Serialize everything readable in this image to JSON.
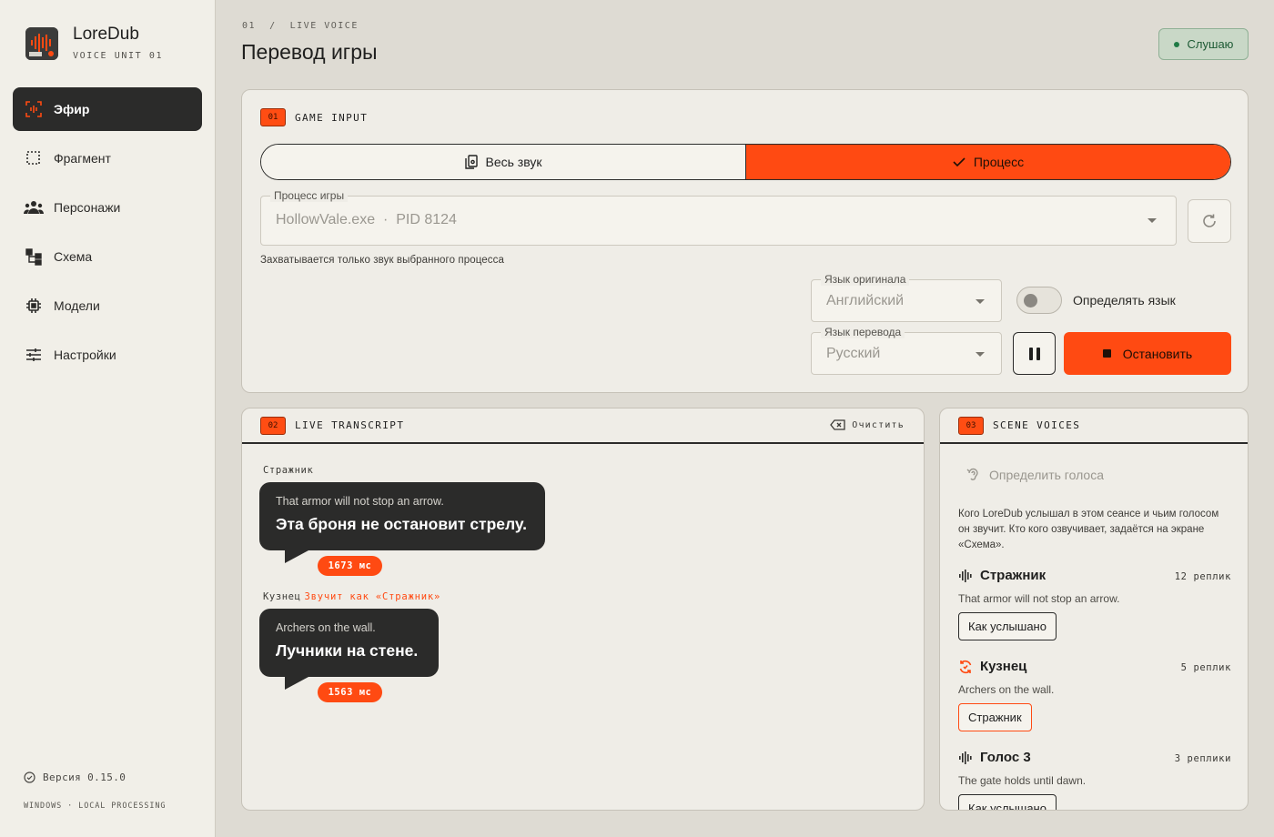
{
  "app": {
    "name": "LoreDub",
    "subtitle": "VOICE UNIT 01"
  },
  "sidebar": {
    "items": [
      {
        "label": "Эфир",
        "icon": "live-scan-icon",
        "active": true
      },
      {
        "label": "Фрагмент",
        "icon": "selection-icon"
      },
      {
        "label": "Персонажи",
        "icon": "people-icon"
      },
      {
        "label": "Схема",
        "icon": "schema-icon"
      },
      {
        "label": "Модели",
        "icon": "chip-icon"
      },
      {
        "label": "Настройки",
        "icon": "sliders-icon"
      }
    ],
    "version": "Версия 0.15.0",
    "platform": "WINDOWS · LOCAL PROCESSING"
  },
  "header": {
    "breadcrumb": "01  /  LIVE VOICE",
    "title": "Перевод игры",
    "status": "Слушаю",
    "status_color": "#1f7a45"
  },
  "input": {
    "badge": "01",
    "label": "GAME INPUT",
    "segments": [
      {
        "label": "Весь звук",
        "active": false
      },
      {
        "label": "Процесс",
        "active": true
      }
    ],
    "process_legend": "Процесс игры",
    "process_value": "HollowVale.exe  ·  PID 8124",
    "hint": "Захватывается только звук выбранного процесса",
    "source_legend": "Язык оригинала",
    "source_value": "Английский",
    "target_legend": "Язык перевода",
    "target_value": "Русский",
    "detect_label": "Определять язык",
    "detect_on": false,
    "stop_label": "Остановить",
    "accent": "#ff4a12"
  },
  "transcript": {
    "badge": "02",
    "label": "LIVE TRANSCRIPT",
    "clear_label": "Очистить",
    "entries": [
      {
        "speaker": "Стражник",
        "sounds_as": "",
        "source": "That armor will not stop an arrow.",
        "translation": "Эта броня не остановит стрелу.",
        "latency": "1673 мс"
      },
      {
        "speaker": "Кузнец",
        "sounds_as": "Звучит как «Стражник»",
        "source": "Archers on the wall.",
        "translation": "Лучники на стене.",
        "latency": "1563 мс"
      }
    ]
  },
  "voices": {
    "badge": "03",
    "label": "SCENE VOICES",
    "detect_label": "Определить голоса",
    "intro": "Кого LoreDub услышал в этом сеансе и чьим голосом он звучит. Кто кого озвучивает, задаётся на экране «Схема».",
    "items": [
      {
        "name": "Стражник",
        "count": "12 реплик",
        "line": "That armor will not stop an arrow.",
        "button": "Как услышано",
        "icon": "waveform-icon"
      },
      {
        "name": "Кузнец",
        "count": "5 реплик",
        "line": "Archers on the wall.",
        "button": "Стражник",
        "icon": "voice-swap-icon"
      },
      {
        "name": "Голос 3",
        "count": "3 реплики",
        "line": "The gate holds until dawn.",
        "button": "Как услышано",
        "icon": "waveform-icon"
      }
    ]
  }
}
